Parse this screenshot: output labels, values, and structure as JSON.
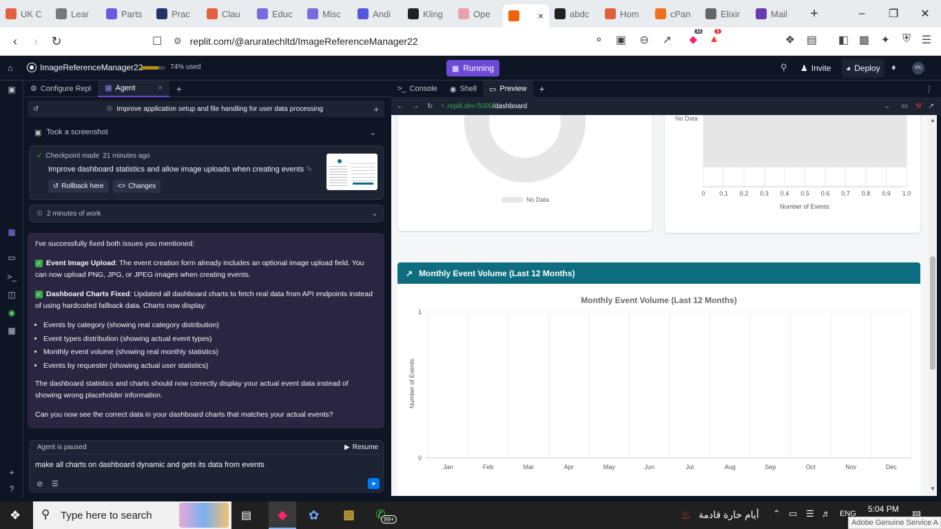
{
  "browser": {
    "tabs": [
      {
        "title": "UK C",
        "fav": "#e06040",
        "icon": "asterisk-icon"
      },
      {
        "title": "Lear",
        "fav": "#777",
        "icon": "person-icon"
      },
      {
        "title": "Parts",
        "fav": "#6a5ae0",
        "icon": "form-icon"
      },
      {
        "title": "Prac",
        "fav": "#223366",
        "icon": "flag-icon"
      },
      {
        "title": "Clau",
        "fav": "#e06040",
        "icon": "asterisk-icon"
      },
      {
        "title": "Educ",
        "fav": "#7a6ae0",
        "icon": "play-icon"
      },
      {
        "title": "Misc",
        "fav": "#7a6ae0",
        "icon": "play-icon"
      },
      {
        "title": "Andi",
        "fav": "#5555dd",
        "icon": "d-icon"
      },
      {
        "title": "Kling",
        "fav": "#222",
        "icon": "kling-icon"
      },
      {
        "title": "Ope",
        "fav": "#e8a0b0",
        "icon": "spinner-icon"
      },
      {
        "title": "",
        "fav": "#f26207",
        "icon": "replit-icon",
        "active": true
      },
      {
        "title": "abdc",
        "fav": "#222",
        "icon": "github-icon"
      },
      {
        "title": "Hom",
        "fav": "#e06040",
        "icon": "asterisk-icon"
      },
      {
        "title": "cPan",
        "fav": "#f07020",
        "icon": "cpanel-icon"
      },
      {
        "title": "Elixir",
        "fav": "#666",
        "icon": "pen-icon"
      },
      {
        "title": "Mail",
        "fav": "#6a3ab0",
        "icon": "mail-icon"
      }
    ],
    "url": "replit.com/@aruratechltd/ImageReferenceManager22",
    "badges": {
      "brave": "11",
      "rewards": "1"
    }
  },
  "replit": {
    "project": "ImageReferenceManager22",
    "usage": "74% used",
    "usage_fraction": 0.74,
    "status": "Running",
    "invite": "Invite",
    "deploy": "Deploy",
    "avatar": "KK"
  },
  "agent_panel": {
    "tabs": [
      "Configure Repl",
      "Agent"
    ],
    "thread_title": "Improve application setup and file handling for user data processing",
    "screenshot_row": "Took a screenshot",
    "checkpoint": {
      "label": "Checkpoint made",
      "time": "21 minutes ago",
      "title": "Improve dashboard statistics and allow image uploads when creating events",
      "rollback": "Rollback here",
      "changes": "Changes"
    },
    "work_row": "2 minutes of work",
    "message": {
      "intro": "I've successfully fixed both issues you mentioned:",
      "p1_bold": "Event Image Upload",
      "p1_text": ": The event creation form already includes an optional image upload field. You can now upload PNG, JPG, or JPEG images when creating events.",
      "p2_bold": "Dashboard Charts Fixed",
      "p2_text": ": Updated all dashboard charts to fetch real data from API endpoints instead of using hardcoded fallback data. Charts now display:",
      "bullets": [
        "Events by category (showing real category distribution)",
        "Event types distribution (showing actual event types)",
        "Monthly event volume (showing real monthly statistics)",
        "Events by requester (showing actual user statistics)"
      ],
      "p3": "The dashboard statistics and charts should now correctly display your actual event data instead of showing wrong placeholder information.",
      "p4": "Can you now see the correct data in your dashboard charts that matches your actual events?"
    },
    "paused": "Agent is paused",
    "resume": "Resume",
    "input_value": "make all charts on dashboard dynamic and gets its data from events"
  },
  "right_pane": {
    "tabs": [
      "Console",
      "Shell",
      "Preview"
    ],
    "preview_url_host": ".replit.dev:5000",
    "preview_url_path": "/dashboard"
  },
  "dashboard": {
    "donut_legend": "No Data",
    "hbar_nodata": "No Data",
    "hbar_xlabel": "Number of Events",
    "section_title": "Monthly Event Volume (Last 12 Months)",
    "section_color": "#0e6e80",
    "chart_title": "Monthly Event Volume (Last 12 Months)",
    "ylabel": "Number of Events"
  },
  "chart_data": [
    {
      "type": "bar",
      "title": "",
      "xlabel": "Number of Events",
      "xlim": [
        0,
        1.0
      ],
      "ticks": [
        "0",
        "0.1",
        "0.2",
        "0.3",
        "0.4",
        "0.5",
        "0.6",
        "0.7",
        "0.8",
        "0.9",
        "1.0"
      ],
      "series": [
        {
          "name": "No Data",
          "values": []
        }
      ]
    },
    {
      "type": "line",
      "title": "Monthly Event Volume (Last 12 Months)",
      "ylabel": "Number of Events",
      "ylim": [
        0,
        1
      ],
      "yticks": [
        "0",
        "1"
      ],
      "categories": [
        "Jan",
        "Feb",
        "Mar",
        "Apr",
        "May",
        "Jun",
        "Jul",
        "Aug",
        "Sep",
        "Oct",
        "Nov",
        "Dec"
      ],
      "series": []
    }
  ],
  "taskbar": {
    "search_placeholder": "Type here to search",
    "weather": "أيام حارة قادمة",
    "lang": "ENG",
    "time": "5:04 PM",
    "notif_badge": "99+",
    "tooltip": "Adobe Genuine Service A"
  }
}
